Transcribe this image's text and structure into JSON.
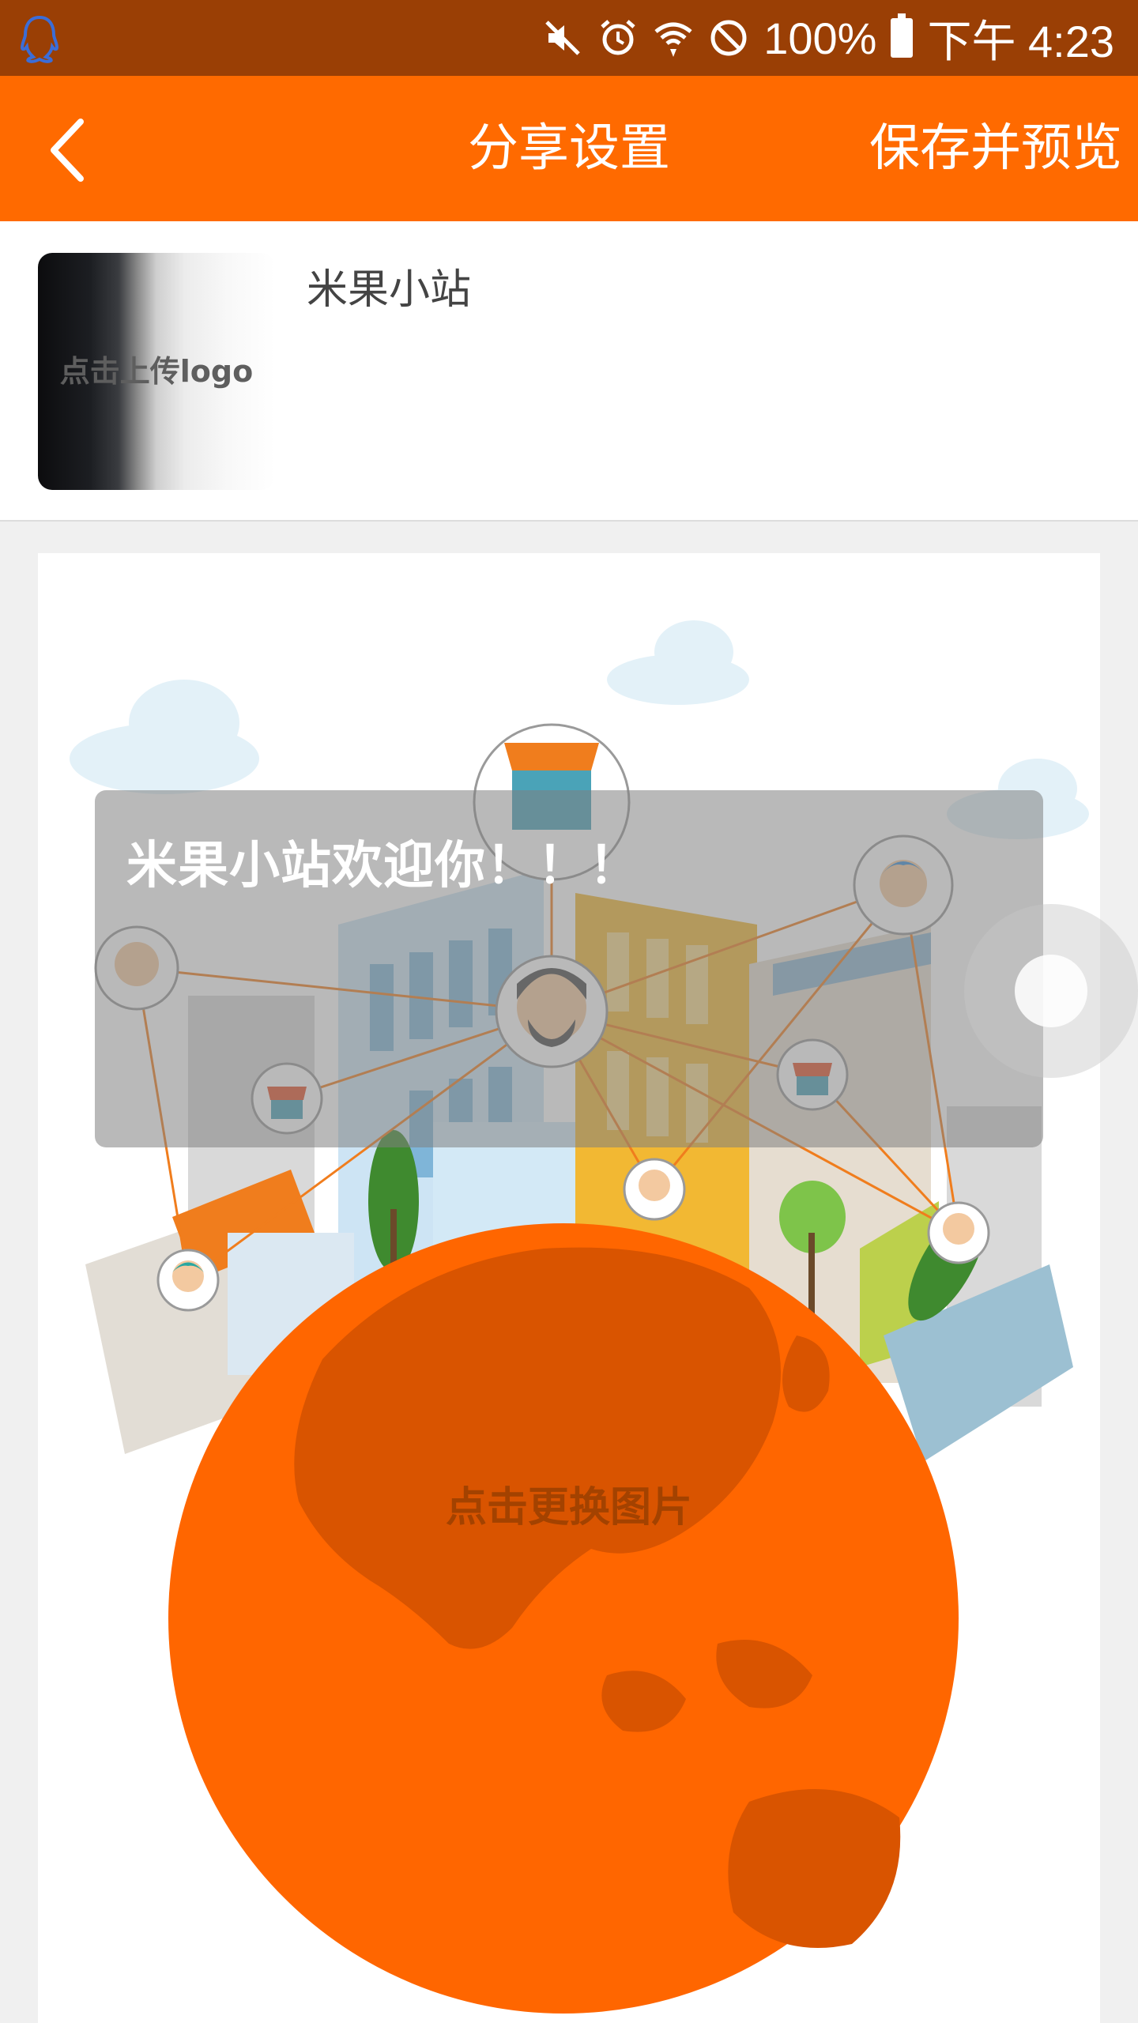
{
  "status_bar": {
    "battery_percent": "100%",
    "time": "下午 4:23",
    "icons": [
      "qq-icon",
      "mute-icon",
      "alarm-icon",
      "wifi-icon",
      "do-not-disturb-icon",
      "battery-icon"
    ]
  },
  "app_bar": {
    "title": "分享设置",
    "save_label": "保存并预览",
    "back_icon": "chevron-left-icon"
  },
  "logo": {
    "upload_text": "点击上传logo",
    "site_name": "米果小站"
  },
  "share_card": {
    "welcome_text": "米果小站欢迎你！！！",
    "change_image_text": "点击更换图片"
  },
  "colors": {
    "status_bar": "#9a3f05",
    "app_bar": "#ff6a00",
    "globe": "#ff6600"
  }
}
